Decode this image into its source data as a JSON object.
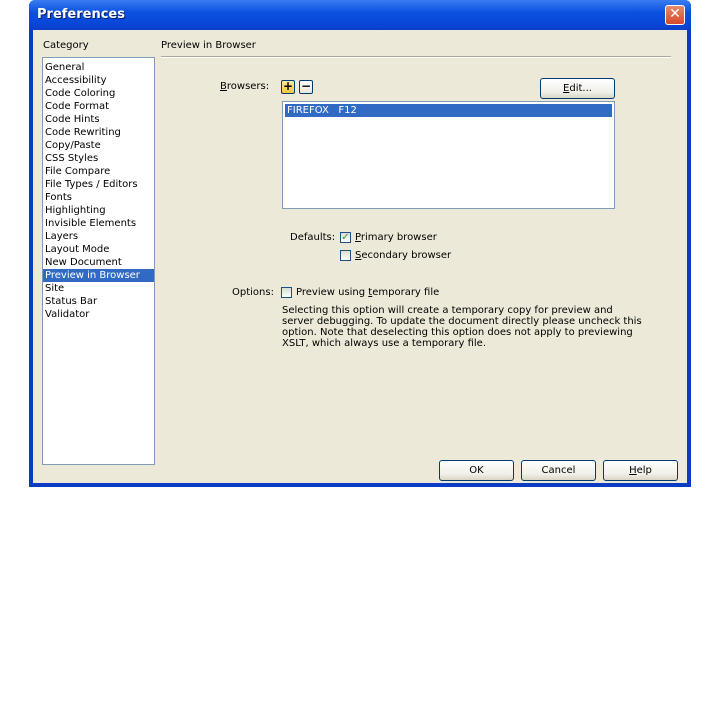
{
  "window": {
    "title": "Preferences",
    "close_icon": "close-icon"
  },
  "category": {
    "label": "Category",
    "items": [
      "General",
      "Accessibility",
      "Code Coloring",
      "Code Format",
      "Code Hints",
      "Code Rewriting",
      "Copy/Paste",
      "CSS Styles",
      "File Compare",
      "File Types / Editors",
      "Fonts",
      "Highlighting",
      "Invisible Elements",
      "Layers",
      "Layout Mode",
      "New Document",
      "Preview in Browser",
      "Site",
      "Status Bar",
      "Validator"
    ],
    "selected": "Preview in Browser"
  },
  "panel": {
    "title": "Preview in Browser",
    "browsers_label_first": "B",
    "browsers_label_rest": "rowsers:",
    "add_symbol": "+",
    "remove_symbol": "−",
    "edit_first": "E",
    "edit_rest": "dit...",
    "browser_list": [
      "FIREFOX   F12"
    ],
    "defaults_label": "Defaults:",
    "primary_first": "P",
    "primary_rest": "rimary browser",
    "primary_checked": true,
    "secondary_first": "S",
    "secondary_rest": "econdary browser",
    "secondary_checked": false,
    "options_label": "Options:",
    "preview_pre": "Preview using ",
    "preview_u": "t",
    "preview_post": "emporary file",
    "preview_checked": false,
    "description": "Selecting this option will create a temporary copy for preview and server debugging. To update the document directly please uncheck this option. Note that deselecting this option does not apply to previewing XSLT, which always use a temporary file."
  },
  "buttons": {
    "ok": "OK",
    "cancel": "Cancel",
    "help_first": "H",
    "help_rest": "elp"
  }
}
